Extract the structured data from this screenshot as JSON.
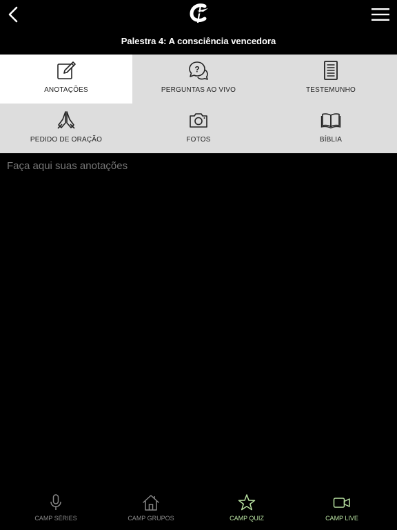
{
  "header": {
    "title": "Palestra 4: A consciência vencedora",
    "back_icon": "chevron-left-icon",
    "menu_icon": "hamburger-menu-icon",
    "logo_icon": "app-logo"
  },
  "grid": {
    "tiles": [
      {
        "label": "ANOTAÇÕES",
        "icon": "edit-note-icon",
        "active": true
      },
      {
        "label": "PERGUNTAS AO VIVO",
        "icon": "chat-question-icon",
        "active": false
      },
      {
        "label": "TESTEMUNHO",
        "icon": "document-icon",
        "active": false
      },
      {
        "label": "PEDIDO DE ORAÇÃO",
        "icon": "praying-hands-icon",
        "active": false
      },
      {
        "label": "FOTOS",
        "icon": "camera-icon",
        "active": false
      },
      {
        "label": "BÍBLIA",
        "icon": "open-book-icon",
        "active": false
      }
    ]
  },
  "notes": {
    "placeholder": "Faça aqui suas anotações",
    "value": ""
  },
  "tabbar": {
    "items": [
      {
        "label": "CAMP SÉRIES",
        "icon": "microphone-icon"
      },
      {
        "label": "CAMP GRUPOS",
        "icon": "home-icon"
      },
      {
        "label": "CAMP QUIZ",
        "icon": "star-icon"
      },
      {
        "label": "CAMP LIVE",
        "icon": "video-camera-icon"
      }
    ],
    "active_color": "#b9e2a2",
    "inactive_color": "#888888"
  }
}
